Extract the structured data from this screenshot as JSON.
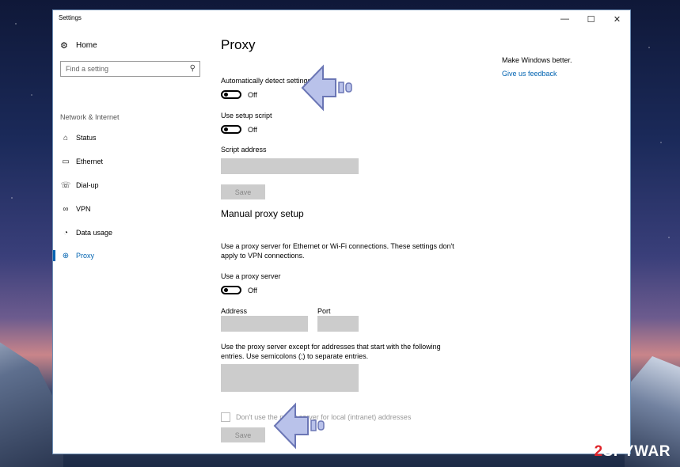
{
  "window": {
    "title": "Settings",
    "controls": {
      "minimize": "—",
      "maximize": "☐",
      "close": "✕"
    }
  },
  "sidebar": {
    "home_label": "Home",
    "search_placeholder": "Find a setting",
    "section_label": "Network & Internet",
    "items": [
      {
        "label": "Status",
        "icon": "status-icon"
      },
      {
        "label": "Ethernet",
        "icon": "ethernet-icon"
      },
      {
        "label": "Dial-up",
        "icon": "dialup-icon"
      },
      {
        "label": "VPN",
        "icon": "vpn-icon"
      },
      {
        "label": "Data usage",
        "icon": "data-usage-icon"
      },
      {
        "label": "Proxy",
        "icon": "globe-icon",
        "active": true
      }
    ]
  },
  "main": {
    "title": "Proxy",
    "auto_detect": {
      "label": "Automatically detect settings",
      "state": "Off"
    },
    "setup_script": {
      "label": "Use setup script",
      "state": "Off"
    },
    "script_address_label": "Script address",
    "save_label_1": "Save",
    "manual_title": "Manual proxy setup",
    "manual_desc": "Use a proxy server for Ethernet or Wi-Fi connections. These settings don't apply to VPN connections.",
    "use_proxy": {
      "label": "Use a proxy server",
      "state": "Off"
    },
    "address_label": "Address",
    "port_label": "Port",
    "exceptions_desc": "Use the proxy server except for addresses that start with the following entries. Use semicolons (;) to separate entries.",
    "local_checkbox_label": "Don't use the proxy server for local (intranet) addresses",
    "save_label_2": "Save"
  },
  "aside": {
    "text": "Make Windows better.",
    "link": "Give us feedback"
  },
  "watermark": {
    "digit": "2",
    "name": "SPYWAR"
  },
  "colors": {
    "accent": "#0063b1",
    "field": "#cccccc"
  }
}
